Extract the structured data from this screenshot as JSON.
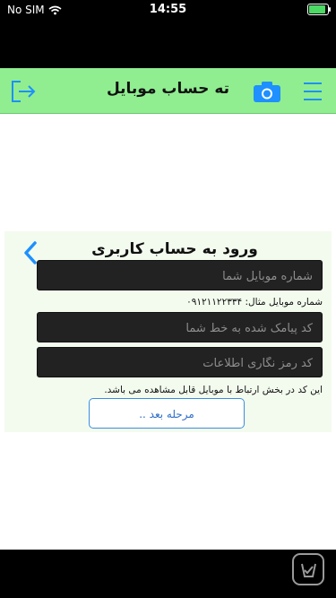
{
  "status_bar": {
    "carrier": "No SIM",
    "time": "14:55"
  },
  "header": {
    "title": "ته حساب موبایل",
    "accent_color": "#1e90ff",
    "background_color": "#90ee90"
  },
  "login": {
    "title": "ورود به حساب کاربری",
    "phone_placeholder": "شماره موبایل شما",
    "phone_hint": "شماره موبایل مثال: ۰۹۱۲۱۱۲۲۳۳۴",
    "sms_placeholder": "کد پیامک شده به خط شما",
    "password_placeholder": "کد رمز نگاری اطلاعات",
    "info_hint": "این کد در بخش ارتباط با موبایل قابل مشاهده می باشد.",
    "next_label": "مرحله بعد .."
  }
}
